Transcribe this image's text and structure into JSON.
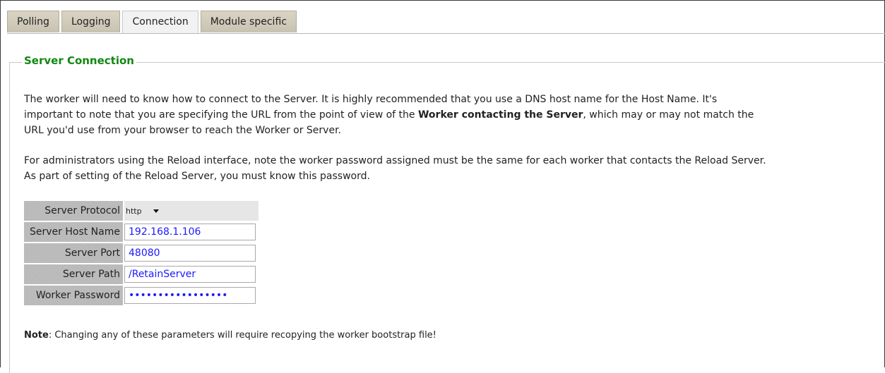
{
  "tabs": [
    {
      "label": "Polling"
    },
    {
      "label": "Logging"
    },
    {
      "label": "Connection"
    },
    {
      "label": "Module specific"
    }
  ],
  "active_tab": "Connection",
  "section": {
    "title": "Server Connection",
    "para1_a": "The worker will need to know how to connect to the Server. It is highly recommended that you use a DNS host name for the Host Name. It's",
    "para1_b": "important to note that you are specifying the URL from the point of view of the ",
    "para1_bold": "Worker contacting the Server",
    "para1_c": ", which may or may not match the",
    "para1_d": "URL you'd use from your browser to reach the Worker or Server.",
    "para2_a": "For administrators using the Reload interface, note the worker password assigned must be the same for each worker that contacts the Reload Server.",
    "para2_b": "As part of setting of the Reload Server, you must know this password."
  },
  "form": {
    "protocol_label": "Server Protocol",
    "protocol_value": "http",
    "host_label": "Server Host Name",
    "host_value": "192.168.1.106",
    "port_label": "Server Port",
    "port_value": "48080",
    "path_label": "Server Path",
    "path_value": "/RetainServer",
    "password_label": "Worker Password",
    "password_value": "•••••••••••••••••"
  },
  "note": {
    "prefix": "Note",
    "text": ": Changing any of these parameters will require recopying the worker bootstrap file!"
  }
}
